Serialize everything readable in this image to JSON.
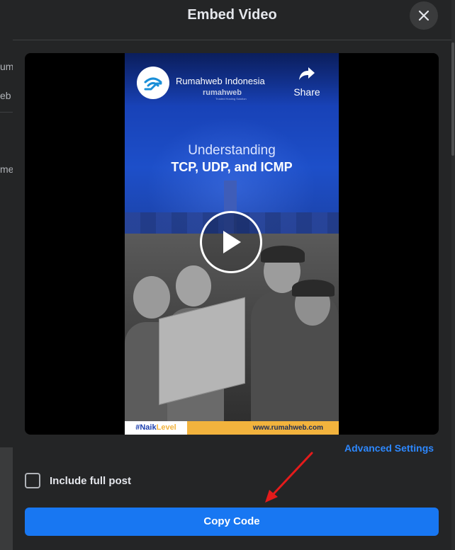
{
  "background_page": {
    "fragments": [
      "uma",
      "eb",
      "me"
    ]
  },
  "dialog": {
    "title": "Embed Video",
    "close_icon": "close-icon"
  },
  "video": {
    "channel_name": "Rumahweb Indonesia",
    "share_label": "Share",
    "share_icon": "share-arrow-icon",
    "play_icon": "play-icon",
    "brand_name": "rumahweb",
    "brand_tagline": "Trusted Hosting Solution",
    "title_line1": "Understanding",
    "title_line2": "TCP, UDP, and ICMP",
    "hashtag_prefix": "#Naik",
    "hashtag_suffix": "Level",
    "website": "www.rumahweb.com"
  },
  "settings": {
    "advanced_label": "Advanced Settings",
    "include_full_post_label": "Include full post",
    "include_full_post_checked": false
  },
  "actions": {
    "copy_code_label": "Copy Code"
  },
  "colors": {
    "accent": "#1877f2",
    "link": "#2d88ff",
    "dialog_bg": "#242526",
    "annotation_arrow": "#e41b1b"
  }
}
